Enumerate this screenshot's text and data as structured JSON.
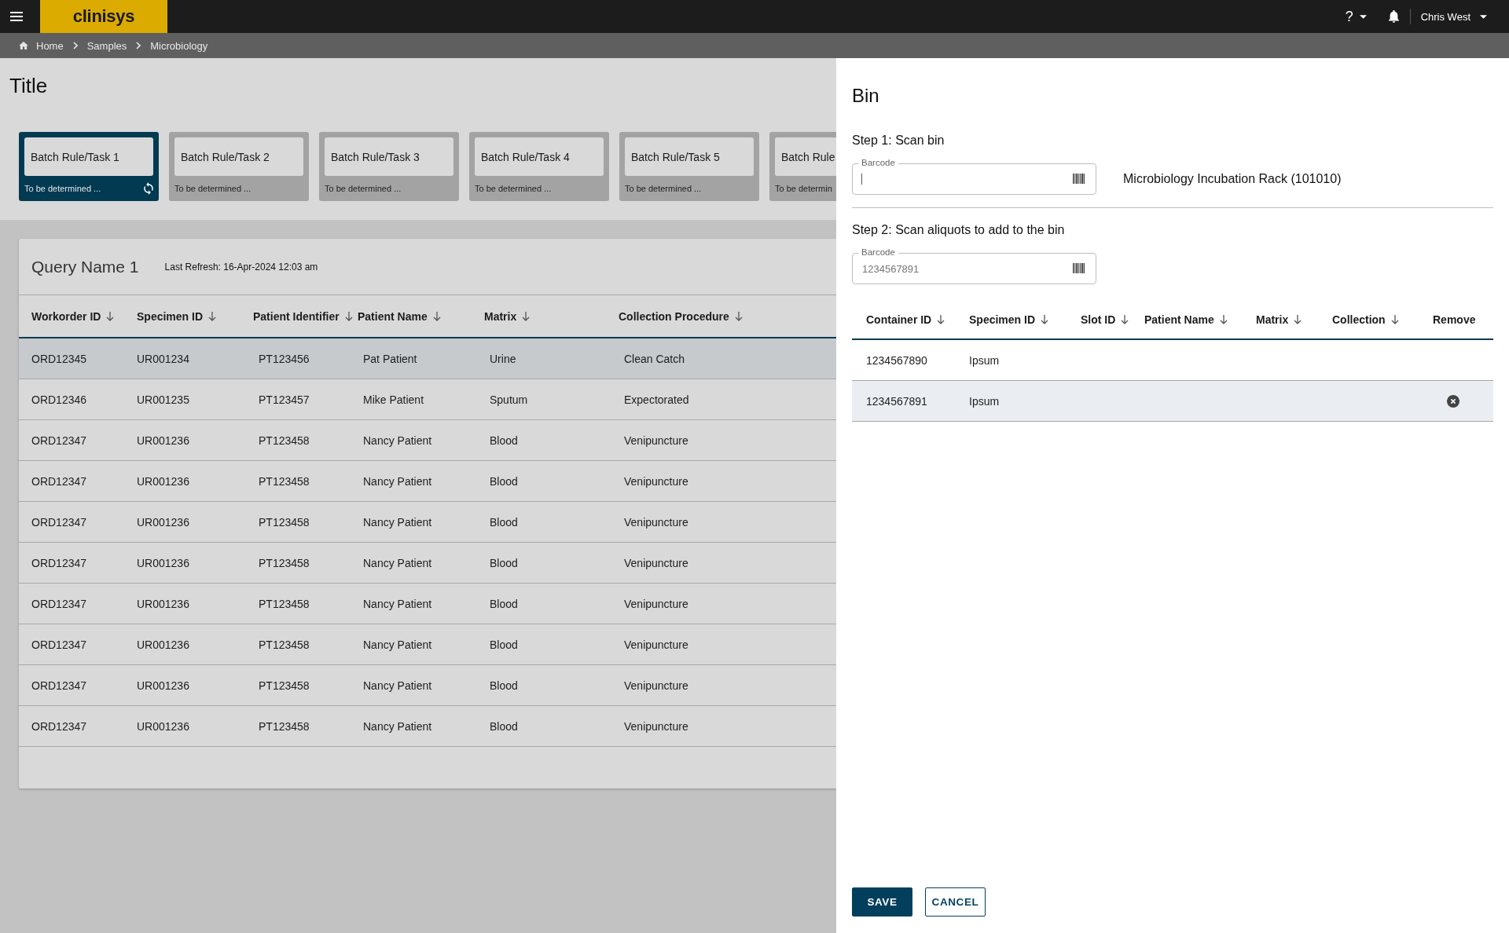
{
  "top_bar": {
    "logo": "clinisys",
    "help": "?",
    "user": "Chris West"
  },
  "breadcrumb": [
    "Home",
    "Samples",
    "Microbiology"
  ],
  "page": {
    "title": "Title"
  },
  "batch_cards": [
    {
      "title": "Batch Rule/Task 1",
      "subtitle": "To be determined ...",
      "selected": true
    },
    {
      "title": "Batch Rule/Task 2",
      "subtitle": "To be determined ...",
      "selected": false
    },
    {
      "title": "Batch Rule/Task 3",
      "subtitle": "To be determined ...",
      "selected": false
    },
    {
      "title": "Batch Rule/Task 4",
      "subtitle": "To be determined ...",
      "selected": false
    },
    {
      "title": "Batch Rule/Task 5",
      "subtitle": "To be determined ...",
      "selected": false
    },
    {
      "title": "Batch Rule",
      "subtitle": "To be determin",
      "selected": false
    }
  ],
  "query": {
    "name": "Query Name 1",
    "last_refresh": "Last Refresh: 16-Apr-2024 12:03 am",
    "columns": [
      {
        "label": "Workorder ID",
        "sortable": true
      },
      {
        "label": "Specimen ID",
        "sortable": true
      },
      {
        "label": "Patient Identifier",
        "sortable": true
      },
      {
        "label": "Patient Name",
        "sortable": true
      },
      {
        "label": "Matrix",
        "sortable": true
      },
      {
        "label": "Collection Procedure",
        "sortable": true
      }
    ],
    "rows": [
      {
        "cells": [
          "ORD12345",
          "UR001234",
          "PT123456",
          "Pat Patient",
          "Urine",
          "Clean Catch"
        ],
        "selected": true
      },
      {
        "cells": [
          "ORD12346",
          "UR001235",
          "PT123457",
          "Mike Patient",
          "Sputum",
          "Expectorated"
        ],
        "selected": false
      },
      {
        "cells": [
          "ORD12347",
          "UR001236",
          "PT123458",
          "Nancy Patient",
          "Blood",
          "Venipuncture"
        ],
        "selected": false
      },
      {
        "cells": [
          "ORD12347",
          "UR001236",
          "PT123458",
          "Nancy Patient",
          "Blood",
          "Venipuncture"
        ],
        "selected": false
      },
      {
        "cells": [
          "ORD12347",
          "UR001236",
          "PT123458",
          "Nancy Patient",
          "Blood",
          "Venipuncture"
        ],
        "selected": false
      },
      {
        "cells": [
          "ORD12347",
          "UR001236",
          "PT123458",
          "Nancy Patient",
          "Blood",
          "Venipuncture"
        ],
        "selected": false
      },
      {
        "cells": [
          "ORD12347",
          "UR001236",
          "PT123458",
          "Nancy Patient",
          "Blood",
          "Venipuncture"
        ],
        "selected": false
      },
      {
        "cells": [
          "ORD12347",
          "UR001236",
          "PT123458",
          "Nancy Patient",
          "Blood",
          "Venipuncture"
        ],
        "selected": false
      },
      {
        "cells": [
          "ORD12347",
          "UR001236",
          "PT123458",
          "Nancy Patient",
          "Blood",
          "Venipuncture"
        ],
        "selected": false
      },
      {
        "cells": [
          "ORD12347",
          "UR001236",
          "PT123458",
          "Nancy Patient",
          "Blood",
          "Venipuncture"
        ],
        "selected": false
      }
    ]
  },
  "bin_panel": {
    "title": "Bin",
    "steps": [
      {
        "label": "Step 1: Scan bin",
        "field": {
          "label": "Barcode",
          "focused": true
        },
        "result": "Microbiology Incubation Rack (101010)"
      },
      {
        "label": "Step 2: Scan aliquots to add to the bin",
        "field": {
          "label": "Barcode",
          "placeholder": "1234567891",
          "focused": false
        }
      }
    ],
    "table": {
      "columns": [
        {
          "label": "Container ID",
          "sortable": true
        },
        {
          "label": "Specimen ID",
          "sortable": true
        },
        {
          "label": "Slot ID",
          "sortable": true
        },
        {
          "label": "Patient Name",
          "sortable": true
        },
        {
          "label": "Matrix",
          "sortable": true
        },
        {
          "label": "Collection",
          "sortable": true
        },
        {
          "label": "Remove",
          "sortable": false
        }
      ],
      "rows": [
        {
          "cells": [
            "1234567890",
            "Ipsum"
          ],
          "selected": false
        },
        {
          "cells": [
            "1234567891",
            "Ipsum"
          ],
          "selected": true
        }
      ]
    },
    "buttons": [
      {
        "label": "SAVE",
        "kind": "primary"
      },
      {
        "label": "CANCEL",
        "kind": "secondary"
      }
    ]
  }
}
